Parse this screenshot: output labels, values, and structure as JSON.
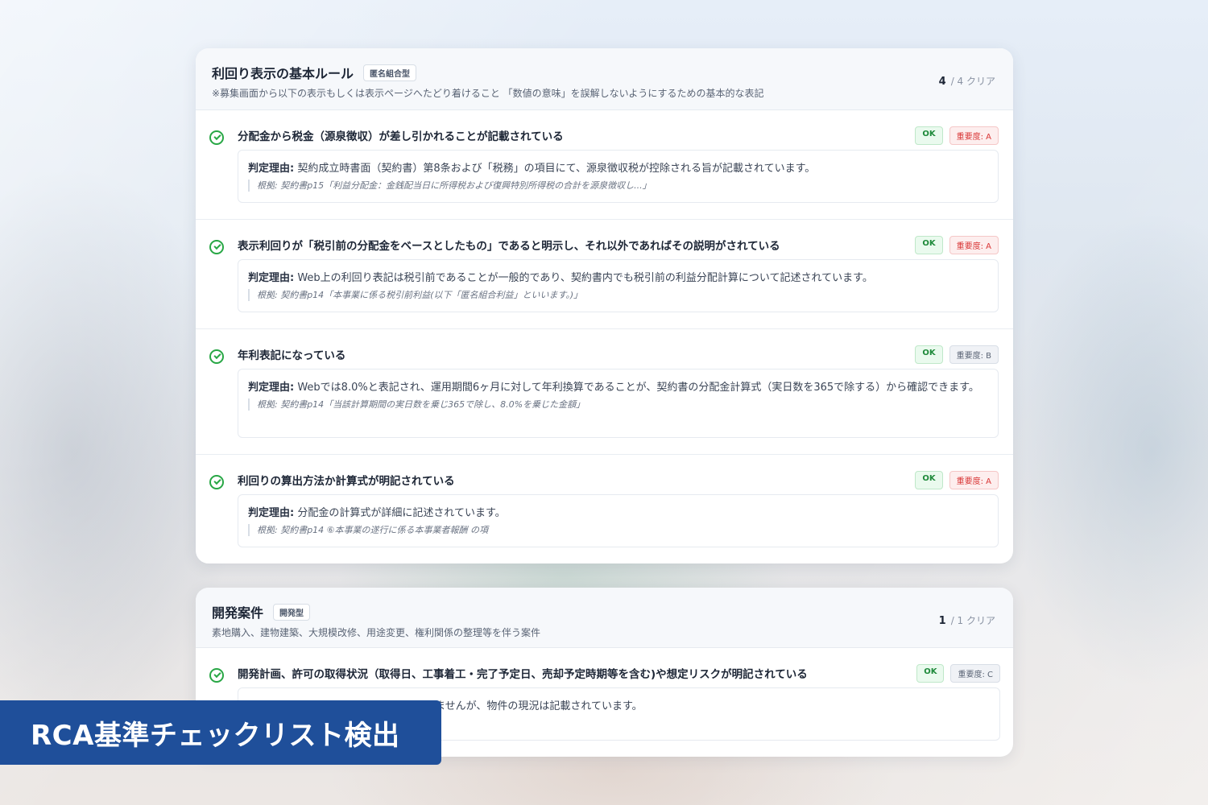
{
  "sections": [
    {
      "title": "利回り表示の基本ルール",
      "type_badge": "匿名組合型",
      "description": "※募集画面から以下の表示もしくは表示ページへたどり着けること 「数値の意味」を誤解しないようにするための基本的な表記",
      "clear_count": "4",
      "clear_total": "/ 4 クリア",
      "items": [
        {
          "title": "分配金から税金（源泉徴収）が差し引かれることが記載されている",
          "status": "OK",
          "severity": "重要度: A",
          "reason_label": "判定理由:",
          "reason": " 契約成立時書面（契約書）第8条および「税務」の項目にて、源泉徴収税が控除される旨が記載されています。",
          "evidence": "根拠: 契約書p15「利益分配金：金銭配当日に所得税および復興特別所得税の合計を源泉徴収し...」"
        },
        {
          "title": "表示利回りが「税引前の分配金をベースとしたもの」であると明示し、それ以外であればその説明がされている",
          "status": "OK",
          "severity": "重要度: A",
          "reason_label": "判定理由:",
          "reason": " Web上の利回り表記は税引前であることが一般的であり、契約書内でも税引前の利益分配計算について記述されています。",
          "evidence": "根拠: 契約書p14「本事業に係る税引前利益(以下「匿名組合利益」といいます。)」"
        },
        {
          "title": "年利表記になっている",
          "status": "OK",
          "severity": "重要度: B",
          "reason_label": "判定理由:",
          "reason": " Webでは8.0%と表記され、運用期間6ヶ月に対して年利換算であることが、契約書の分配金計算式（実日数を365で除する）から確認できます。",
          "evidence": "根拠: 契約書p14「当該計算期間の実日数を乗じ365で除し、8.0%を乗じた金額」"
        },
        {
          "title": "利回りの算出方法か計算式が明記されている",
          "status": "OK",
          "severity": "重要度: A",
          "reason_label": "判定理由:",
          "reason": " 分配金の計算式が詳細に記述されています。",
          "evidence": "根拠: 契約書p14 ⑥本事業の遂行に係る本事業者報酬 の項"
        }
      ]
    },
    {
      "title": "開発案件",
      "type_badge": "開発型",
      "description": "素地購入、建物建築、大規模改修、用途変更、権利関係の整理等を伴う案件",
      "clear_count": "1",
      "clear_total": "/ 1 クリア",
      "items": [
        {
          "title": "開発計画、許可の取得状況（取得日、工事着工・完了予定日、売却予定時期等を含む)や想定リスクが明記されている",
          "status": "OK",
          "severity": "重要度: C",
          "reason_visible": "ませんが、物件の現況は記載されています。"
        }
      ]
    }
  ],
  "banner": {
    "text": "RCA基準チェックリスト検出",
    "color": "#1f4f9a"
  },
  "colors": {
    "ok_green": "#28a745",
    "severity_a_red": "#d93636"
  }
}
